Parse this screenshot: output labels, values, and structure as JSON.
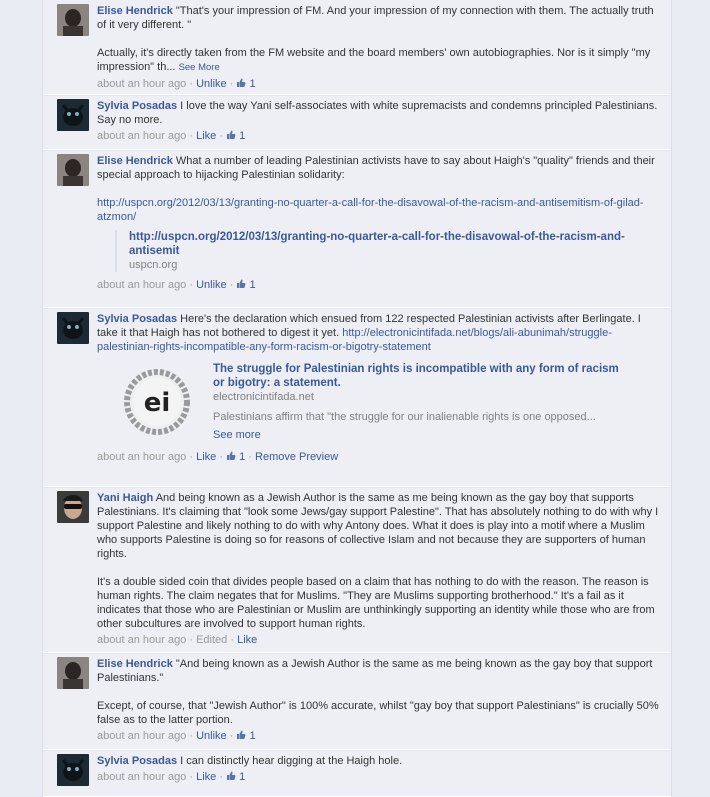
{
  "thread": {
    "comments": [
      {
        "author": "Elise Hendrick",
        "text1": "\"That's your impression of FM. And your impression of my connection with them. The actually truth of it very different. \"",
        "text2": "Actually, it's directly taken from the FM website and the board members' own autobiographies. Nor is it simply \"my impression\" th...",
        "see_more": "See More",
        "time": "about an hour ago",
        "action": "Unlike",
        "likes": "1"
      },
      {
        "author": "Sylvia Posadas",
        "text1": "I love the way Yani self-associates with white supremacists and condemns principled Palestinians. Say no more.",
        "time": "about an hour ago",
        "action": "Like",
        "likes": "1"
      },
      {
        "author": "Elise Hendrick",
        "text1": "What a number of leading Palestinian activists have to say about Haigh's \"quality\" friends and their special approach to hijacking Palestinian solidarity:",
        "url": "http://uspcn.org/2012/03/13/granting-no-quarter-a-call-for-the-disavowal-of-the-racism-and-antisemitism-of-gilad-atzmon/",
        "attach_title": "http://uspcn.org/2012/03/13/granting-no-quarter-a-call-for-the-disavowal-of-the-racism-and-antisemit",
        "attach_domain": "uspcn.org",
        "time": "about an hour ago",
        "action": "Unlike",
        "likes": "1"
      },
      {
        "author": "Sylvia Posadas",
        "text1": "Here's the declaration which ensued from 122 respected Palestinian activists after Berlingate. I take it that Haigh has not bothered to digest it yet.",
        "url": "http://electronicintifada.net/blogs/ali-abunimah/struggle-palestinian-rights-incompatible-any-form-racism-or-bigotry-statement",
        "preview_logo": "ei",
        "preview_title": "The struggle for Palestinian rights is incompatible with any form of racism or bigotry: a statement.",
        "preview_domain": "electronicintifada.net",
        "preview_desc": "Palestinians affirm that \"the struggle for our inalienable rights is one opposed...",
        "preview_see_more": "See more",
        "time": "about an hour ago",
        "action": "Like",
        "likes": "1",
        "remove": "Remove Preview"
      },
      {
        "author": "Yani Haigh",
        "text1": "And being known as a Jewish Author is the same as me being known as the gay boy that supports Palestinians. It's claiming that \"look some Jews/gay support Palestine\". That has absolutely nothing to do with why I support Palestine and likely nothing to do with why Antony does. What it does is play into a motif where a Muslim who supports Palestine is doing so for reasons of collective Islam and not because they are supporters of human rights.",
        "text2": "It's a double sided coin that divides people based on a claim that has nothing to do with the reason. The reason is human rights. The claim negates that for Muslims. \"They are Muslims supporting brotherhood.\" It's a fail as it indicates that those who are Palestinian or Muslim are unthinkingly supporting an identity while those who are from other subcultures are involved to support human rights.",
        "time": "about an hour ago",
        "edited": "Edited",
        "action": "Like"
      },
      {
        "author": "Elise Hendrick",
        "text1": "\"And being known as a Jewish Author is the same as me being known as the gay boy that support Palestinians.\"",
        "text2": "Except, of course, that \"Jewish Author\" is 100% accurate, whilst \"gay boy that support Palestinians\" is crucially 50% false as to the latter portion.",
        "time": "about an hour ago",
        "action": "Unlike",
        "likes": "1"
      },
      {
        "author": "Sylvia Posadas",
        "text1": "I can distinctly hear digging at the Haigh hole.",
        "time": "about an hour ago",
        "action": "Like",
        "likes": "1"
      }
    ]
  },
  "colors": {
    "link": "#3b5998",
    "meta": "#999999",
    "background": "#edeff4"
  },
  "icons": {
    "like": "thumbs-up-icon"
  }
}
